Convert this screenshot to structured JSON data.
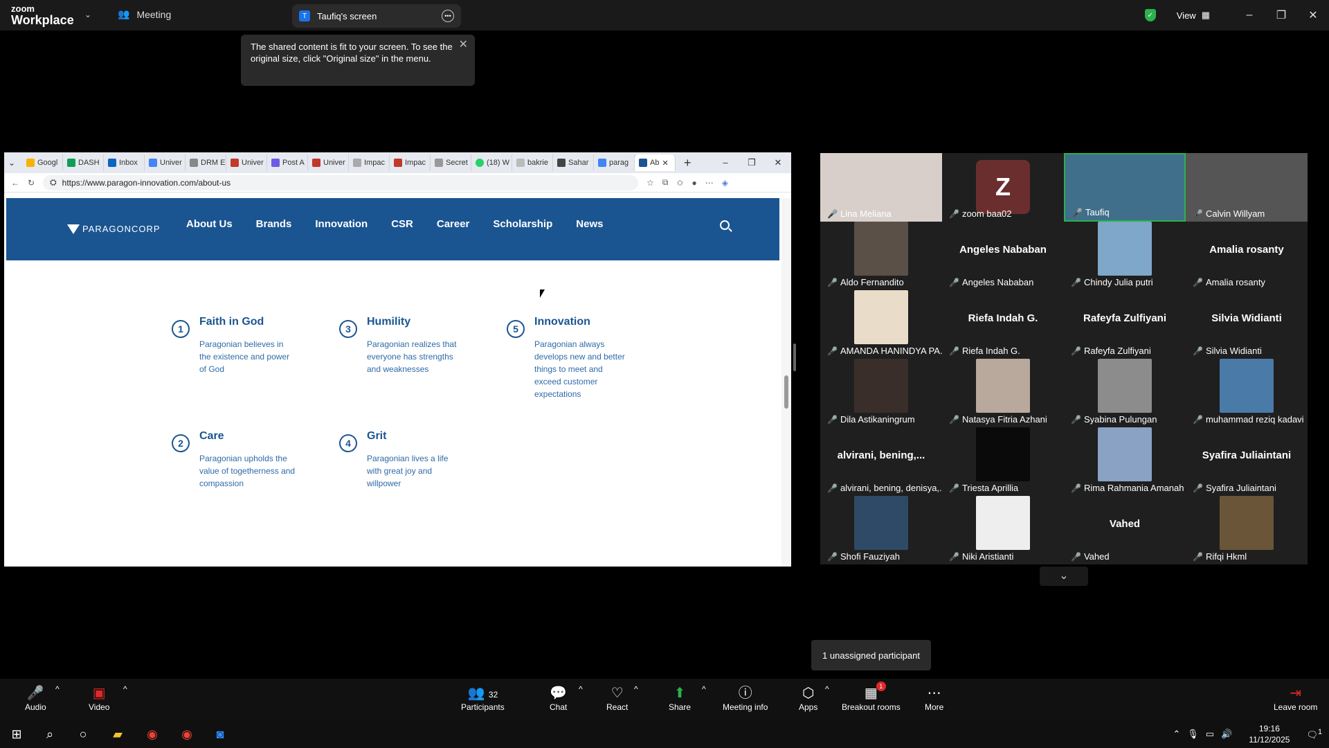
{
  "zoom": {
    "logo_top": "zoom",
    "logo_bottom": "Workplace",
    "meeting_tab": "Meeting",
    "share_tab": "Taufiq's screen",
    "share_badge": "T",
    "view_label": "View",
    "notice": "The shared content is fit to your screen. To see the original size, click \"Original size\" in the menu."
  },
  "browser": {
    "tabs": [
      "Googl",
      "DASH",
      "Inbox",
      "Univer",
      "DRM E",
      "Univer",
      "Post A",
      "Univer",
      "Impac",
      "Impac",
      "Secret",
      "(18) W",
      "bakrie",
      "Sahar",
      "parag",
      "Ab"
    ],
    "url": "https://www.paragon-innovation.com/about-us"
  },
  "site": {
    "brand": "PARAGONCORP",
    "nav": [
      "About Us",
      "Brands",
      "Innovation",
      "CSR",
      "Career",
      "Scholarship",
      "News"
    ],
    "values": [
      {
        "num": "1",
        "title": "Faith in God",
        "desc": "Paragonian believes in the existence and power of God"
      },
      {
        "num": "3",
        "title": "Humility",
        "desc": "Paragonian realizes that everyone has strengths and weaknesses"
      },
      {
        "num": "5",
        "title": "Innovation",
        "desc": "Paragonian always develops new and better things to meet and exceed customer expectations"
      },
      {
        "num": "2",
        "title": "Care",
        "desc": "Paragonian upholds the value of togetherness and compassion"
      },
      {
        "num": "4",
        "title": "Grit",
        "desc": "Paragonian lives a life with great joy and willpower"
      }
    ]
  },
  "gallery": [
    {
      "name": "Lina Meliana",
      "type": "video",
      "color": "#d8cfcb"
    },
    {
      "name": "zoom baa02",
      "type": "avatar",
      "avatar": "Z"
    },
    {
      "name": "Taufiq",
      "type": "video",
      "color": "#3f6f8a",
      "highlight": true
    },
    {
      "name": "Calvin Willyam",
      "type": "video",
      "color": "#555"
    },
    {
      "name": "Aldo Fernandito",
      "type": "pic",
      "color": "#5a5048"
    },
    {
      "name": "Angeles Nababan",
      "type": "name",
      "big": "Angeles Nababan"
    },
    {
      "name": "Chindy Julia putri",
      "type": "pic",
      "color": "#7fa7c9"
    },
    {
      "name": "Amalia rosanty",
      "type": "name",
      "big": "Amalia rosanty"
    },
    {
      "name": "AMANDA HANINDYA PA...",
      "type": "pic",
      "color": "#e9dcc9"
    },
    {
      "name": "Riefa Indah G.",
      "type": "name",
      "big": "Riefa Indah G."
    },
    {
      "name": "Rafeyfa Zulfiyani",
      "type": "name",
      "big": "Rafeyfa Zulfiyani"
    },
    {
      "name": "Silvia Widianti",
      "type": "name",
      "big": "Silvia Widianti"
    },
    {
      "name": "Dila Astikaningrum",
      "type": "pic",
      "color": "#3a2e2a"
    },
    {
      "name": "Natasya Fitria Azhani",
      "type": "pic",
      "color": "#b9a89c"
    },
    {
      "name": "Syabina Pulungan",
      "type": "pic",
      "color": "#8c8c8c"
    },
    {
      "name": "muhammad reziq kadavi",
      "type": "pic",
      "color": "#4a7aa8"
    },
    {
      "name": "alvirani, bening, denisya,...",
      "type": "name",
      "big": "alvirani,  bening,..."
    },
    {
      "name": "Triesta Aprillia",
      "type": "pic",
      "color": "#0a0a0a"
    },
    {
      "name": "Rima Rahmania Amanah",
      "type": "pic",
      "color": "#8aa3c4"
    },
    {
      "name": "Syafira Juliaintani",
      "type": "name",
      "big": "Syafira Juliaintani"
    },
    {
      "name": "Shofi Fauziyah",
      "type": "pic",
      "color": "#2e4a66"
    },
    {
      "name": "Niki Aristianti",
      "type": "pic",
      "color": "#eeeeee"
    },
    {
      "name": "Vahed",
      "type": "name",
      "big": "Vahed"
    },
    {
      "name": "Rifqi Hkml",
      "type": "pic",
      "color": "#6a5538"
    }
  ],
  "unassigned": "1 unassigned participant",
  "toolbar": {
    "audio": "Audio",
    "video": "Video",
    "participants": "Participants",
    "participants_count": "32",
    "chat": "Chat",
    "react": "React",
    "share": "Share",
    "meeting_info": "Meeting info",
    "apps": "Apps",
    "breakout": "Breakout rooms",
    "breakout_badge": "1",
    "more": "More",
    "leave": "Leave room"
  },
  "taskbar": {
    "time": "19:16",
    "date": "11/12/2025",
    "notif": "1"
  }
}
